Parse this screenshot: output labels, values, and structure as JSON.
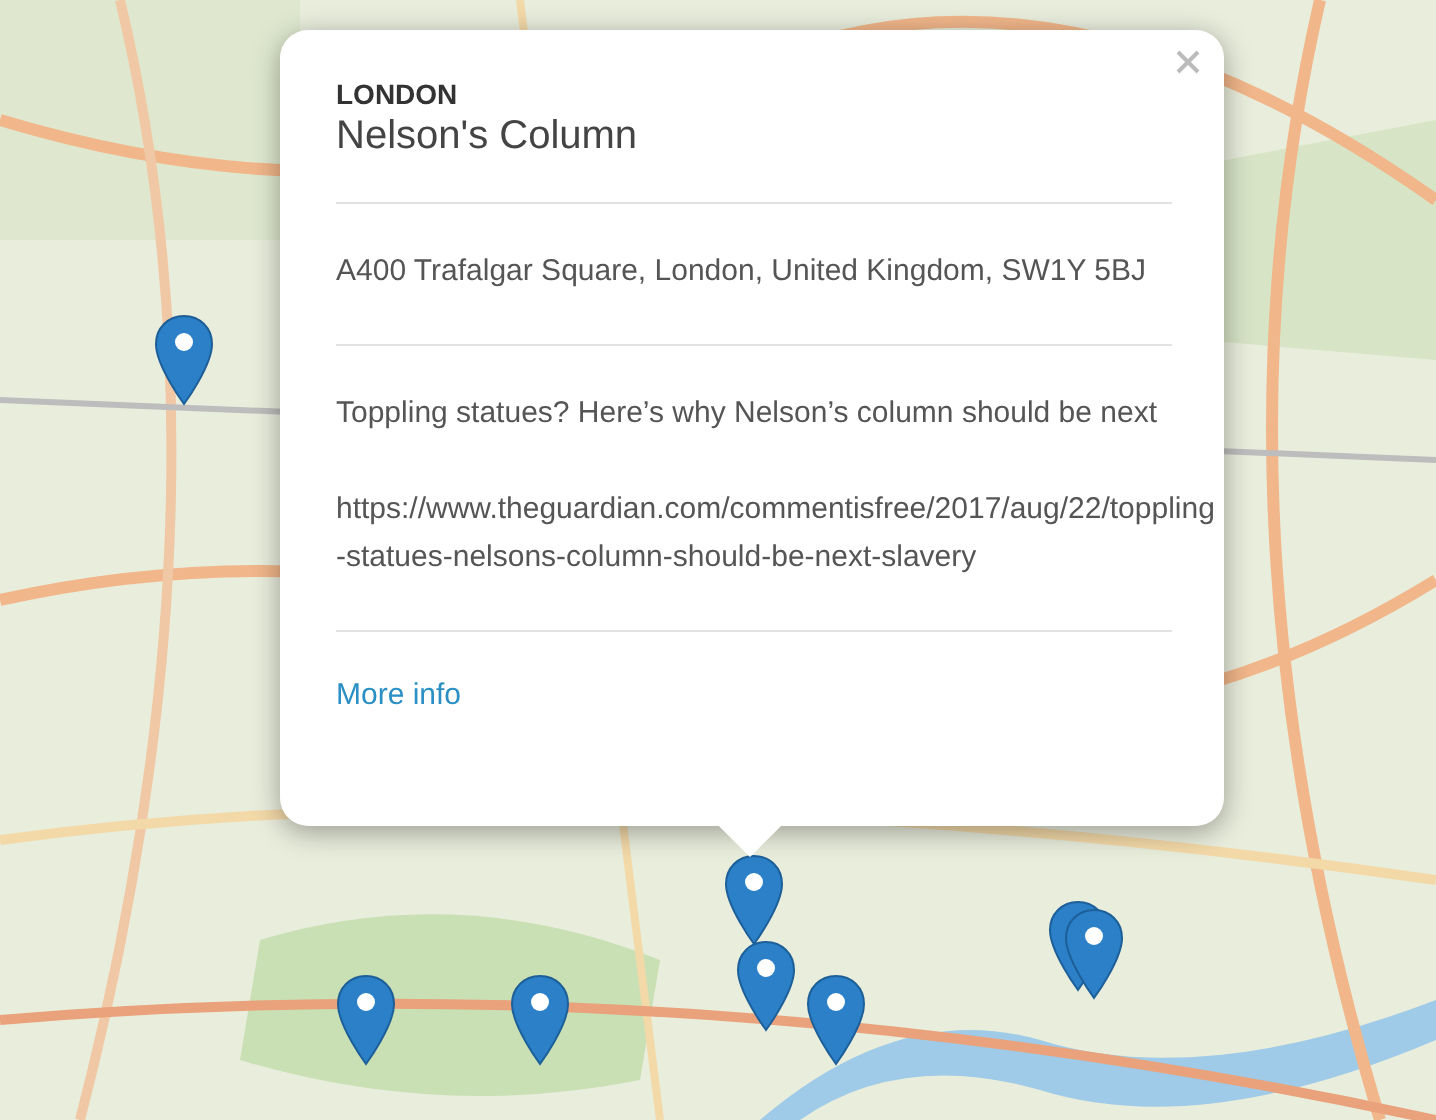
{
  "popup": {
    "region": "LONDON",
    "title": "Nelson's Column",
    "address": "A400 Trafalgar Square, London, United Kingdom, SW1Y 5BJ",
    "description": "Toppling statues? Here’s why Nelson’s column should be next",
    "url": "https://www.theguardian.com/commentisfree/2017/aug/22/toppling-statues-nelsons-column-should-be-next-slavery",
    "link": "More info"
  }
}
